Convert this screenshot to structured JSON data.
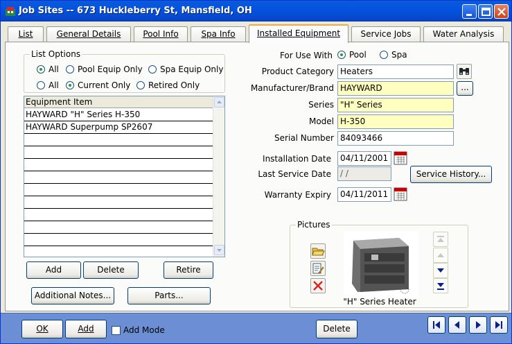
{
  "window": {
    "title": "Job Sites -- 673 Huckleberry St, Mansfield, OH"
  },
  "tabs": [
    {
      "label": "List",
      "active": false
    },
    {
      "label": "General Details",
      "active": false
    },
    {
      "label": "Pool Info",
      "active": false
    },
    {
      "label": "Spa Info",
      "active": false
    },
    {
      "label": "Installed Equipment",
      "active": true
    },
    {
      "label": "Service Jobs",
      "active": false
    },
    {
      "label": "Water Analysis",
      "active": false
    }
  ],
  "list_options": {
    "group_label": "List Options",
    "row1": [
      {
        "label": "All",
        "selected": true
      },
      {
        "label": "Pool Equip Only",
        "selected": false
      },
      {
        "label": "Spa Equip Only",
        "selected": false
      }
    ],
    "row2": [
      {
        "label": "All",
        "selected": false
      },
      {
        "label": "Current Only",
        "selected": true
      },
      {
        "label": "Retired Only",
        "selected": false
      }
    ]
  },
  "equipment_list": {
    "header": "Equipment Item",
    "items": [
      "HAYWARD \"H\" Series  H-350",
      "HAYWARD Superpump  SP2607"
    ]
  },
  "list_buttons": {
    "add": "Add",
    "delete": "Delete",
    "retire": "Retire",
    "additional_notes": "Additional Notes...",
    "parts": "Parts..."
  },
  "details": {
    "for_use_with_label": "For Use With",
    "for_use_with_options": [
      {
        "label": "Pool",
        "selected": true
      },
      {
        "label": "Spa",
        "selected": false
      }
    ],
    "product_category_label": "Product Category",
    "product_category": "Heaters",
    "manufacturer_label": "Manufacturer/Brand",
    "manufacturer": "HAYWARD",
    "browse_label": "...",
    "series_label": "Series",
    "series": "\"H\" Series",
    "model_label": "Model",
    "model": "H-350",
    "serial_label": "Serial Number",
    "serial": "84093466",
    "installation_date_label": "Installation Date",
    "installation_date": "04/11/2001",
    "last_service_label": "Last Service Date",
    "last_service": " / /",
    "service_history_label": "Service History...",
    "warranty_label": "Warranty Expiry",
    "warranty": "04/11/2011"
  },
  "pictures": {
    "group_label": "Pictures",
    "caption": "\"H\" Series Heater"
  },
  "bottom": {
    "ok": "OK",
    "add": "Add",
    "add_mode": "Add Mode",
    "delete": "Delete"
  },
  "colors": {
    "title_bar": "#0453e2",
    "yellow_field": "#ffffc0",
    "bottom_bar": "#6c8ed4",
    "nav_arrow": "#0a1f8f"
  }
}
